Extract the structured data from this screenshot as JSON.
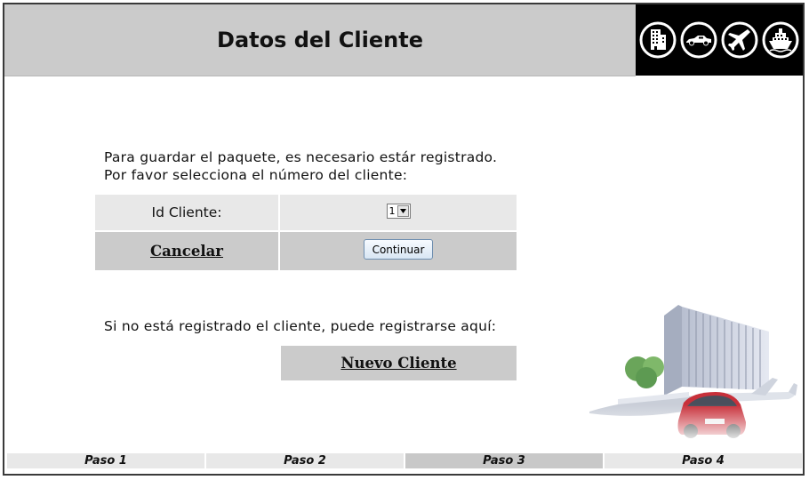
{
  "header": {
    "title": "Datos del Cliente",
    "icons": [
      "hotel-icon",
      "car-icon",
      "airplane-icon",
      "ship-icon"
    ]
  },
  "instructions": {
    "line1": "Para guardar el paquete, es necesario estár registrado.",
    "line2": "Por favor selecciona el número del cliente:"
  },
  "form": {
    "id_label": "Id Cliente:",
    "id_selected": "1",
    "cancel_label": "Cancelar",
    "continue_label": "Continuar"
  },
  "register": {
    "text": "Si no está registrado el cliente, puede registrarse aquí:",
    "new_client_label": "Nuevo Cliente"
  },
  "steps": [
    {
      "label": "Paso 1"
    },
    {
      "label": "Paso 2"
    },
    {
      "label": "Paso 3",
      "active": true
    },
    {
      "label": "Paso 4"
    }
  ],
  "colors": {
    "header_bg": "#cbcbcb",
    "icon_bar_bg": "#000000",
    "light_cell": "#e8e8e8",
    "dark_cell": "#cbcbcb"
  }
}
